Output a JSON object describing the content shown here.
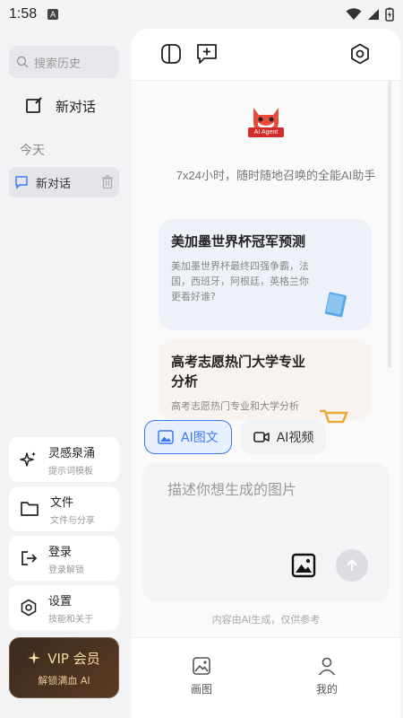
{
  "status_bar": {
    "time": "1:58",
    "badge": "A"
  },
  "sidebar": {
    "search_placeholder": "搜索历史",
    "new_chat_label": "新对话",
    "section_today": "今天",
    "history": [
      {
        "label": "新对话"
      }
    ],
    "menu": [
      {
        "title": "灵感泉涌",
        "subtitle": "提示词模板",
        "icon": "sparkle-icon"
      },
      {
        "title": "文件",
        "subtitle": "文件与分享",
        "icon": "folder-icon"
      },
      {
        "title": "登录",
        "subtitle": "登录解锁",
        "icon": "login-icon"
      },
      {
        "title": "设置",
        "subtitle": "技能和关于",
        "icon": "settings-icon"
      }
    ],
    "vip": {
      "title": "VIP 会员",
      "subtitle": "解锁满血 AI"
    }
  },
  "main": {
    "logo_text": "AI Agent",
    "tagline": "7x24小时，随时随地召唤的全能AI助手",
    "suggestions": [
      {
        "title": "美加墨世界杯冠军预测",
        "desc": "美加墨世界杯最终四强争霸，法国，西班牙，阿根廷，英格兰你更看好谁?"
      },
      {
        "title": "高考志愿热门大学专业分析",
        "desc": "高考志愿热门专业和大学分析"
      }
    ],
    "mode_tabs": [
      {
        "label": "AI图文",
        "active": true
      },
      {
        "label": "AI视频",
        "active": false
      }
    ],
    "input_placeholder": "描述你想生成的图片",
    "disclaimer": "内容由AI生成，仅供参考",
    "bottom_nav": [
      {
        "label": "画图"
      },
      {
        "label": "我的"
      }
    ]
  },
  "colors": {
    "accent": "#3a78f2",
    "vip_gold": "#f6d9a6",
    "brand_red": "#d62b2b"
  }
}
